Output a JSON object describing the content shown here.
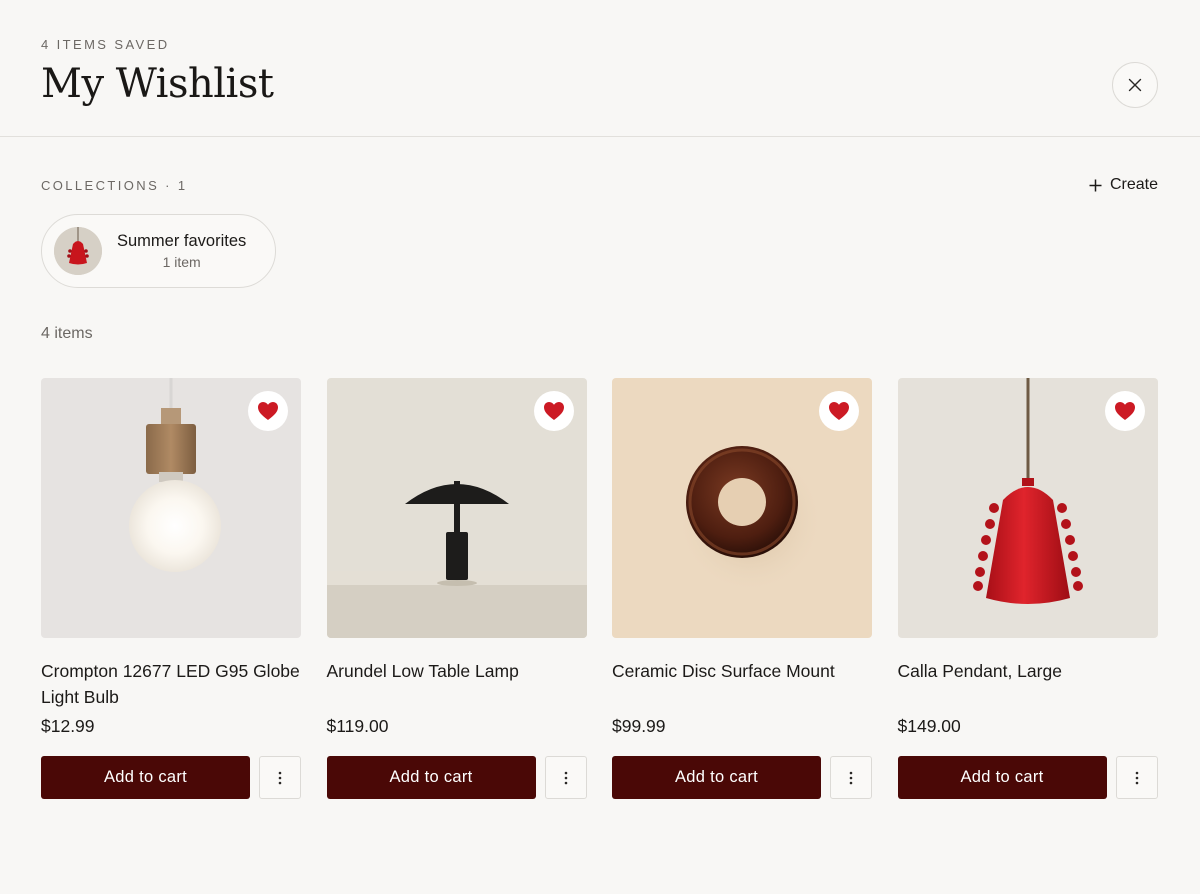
{
  "header": {
    "eyebrow": "4 ITEMS SAVED",
    "title": "My Wishlist",
    "close_icon": "close-icon"
  },
  "collections": {
    "label": "COLLECTIONS · 1",
    "create_label": "Create",
    "items": [
      {
        "name": "Summer favorites",
        "count": "1 item"
      }
    ]
  },
  "items_count": "4 items",
  "products": [
    {
      "name": "Crompton 12677 LED G95 Globe Light Bulb",
      "price": "$12.99",
      "add_label": "Add to cart",
      "favorited": true
    },
    {
      "name": "Arundel Low Table Lamp",
      "price": "$119.00",
      "add_label": "Add to cart",
      "favorited": true
    },
    {
      "name": "Ceramic Disc Surface Mount",
      "price": "$99.99",
      "add_label": "Add to cart",
      "favorited": true
    },
    {
      "name": "Calla Pendant, Large",
      "price": "$149.00",
      "add_label": "Add to cart",
      "favorited": true
    }
  ],
  "colors": {
    "accent": "#4a0806",
    "heart": "#cc1a24",
    "background": "#f8f7f5"
  }
}
